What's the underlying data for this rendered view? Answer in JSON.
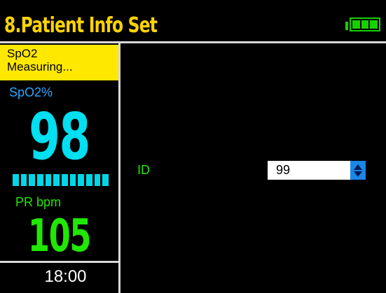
{
  "header": {
    "title": "8.Patient Info Set",
    "battery_icon": "battery-full-icon",
    "battery_color": "#18d000",
    "battery_cells_filled": 3,
    "battery_cells_total": 3
  },
  "sidebar": {
    "status": {
      "line1": "SpO2",
      "line2": "Measuring..."
    },
    "spo2": {
      "label": "SpO2%",
      "value": "98"
    },
    "pleth_segments": 12,
    "pr": {
      "label": "PR bpm",
      "value": "105"
    },
    "time": "18:00"
  },
  "main": {
    "field_label": "ID",
    "field_value": "99",
    "spin_icon": "up-down-arrows-icon"
  },
  "colors": {
    "header_title": "#ffd400",
    "status_bg": "#ffe800",
    "spo2": "#00e0f0",
    "pr": "#20e800",
    "spin_accent": "#1a86e6"
  }
}
